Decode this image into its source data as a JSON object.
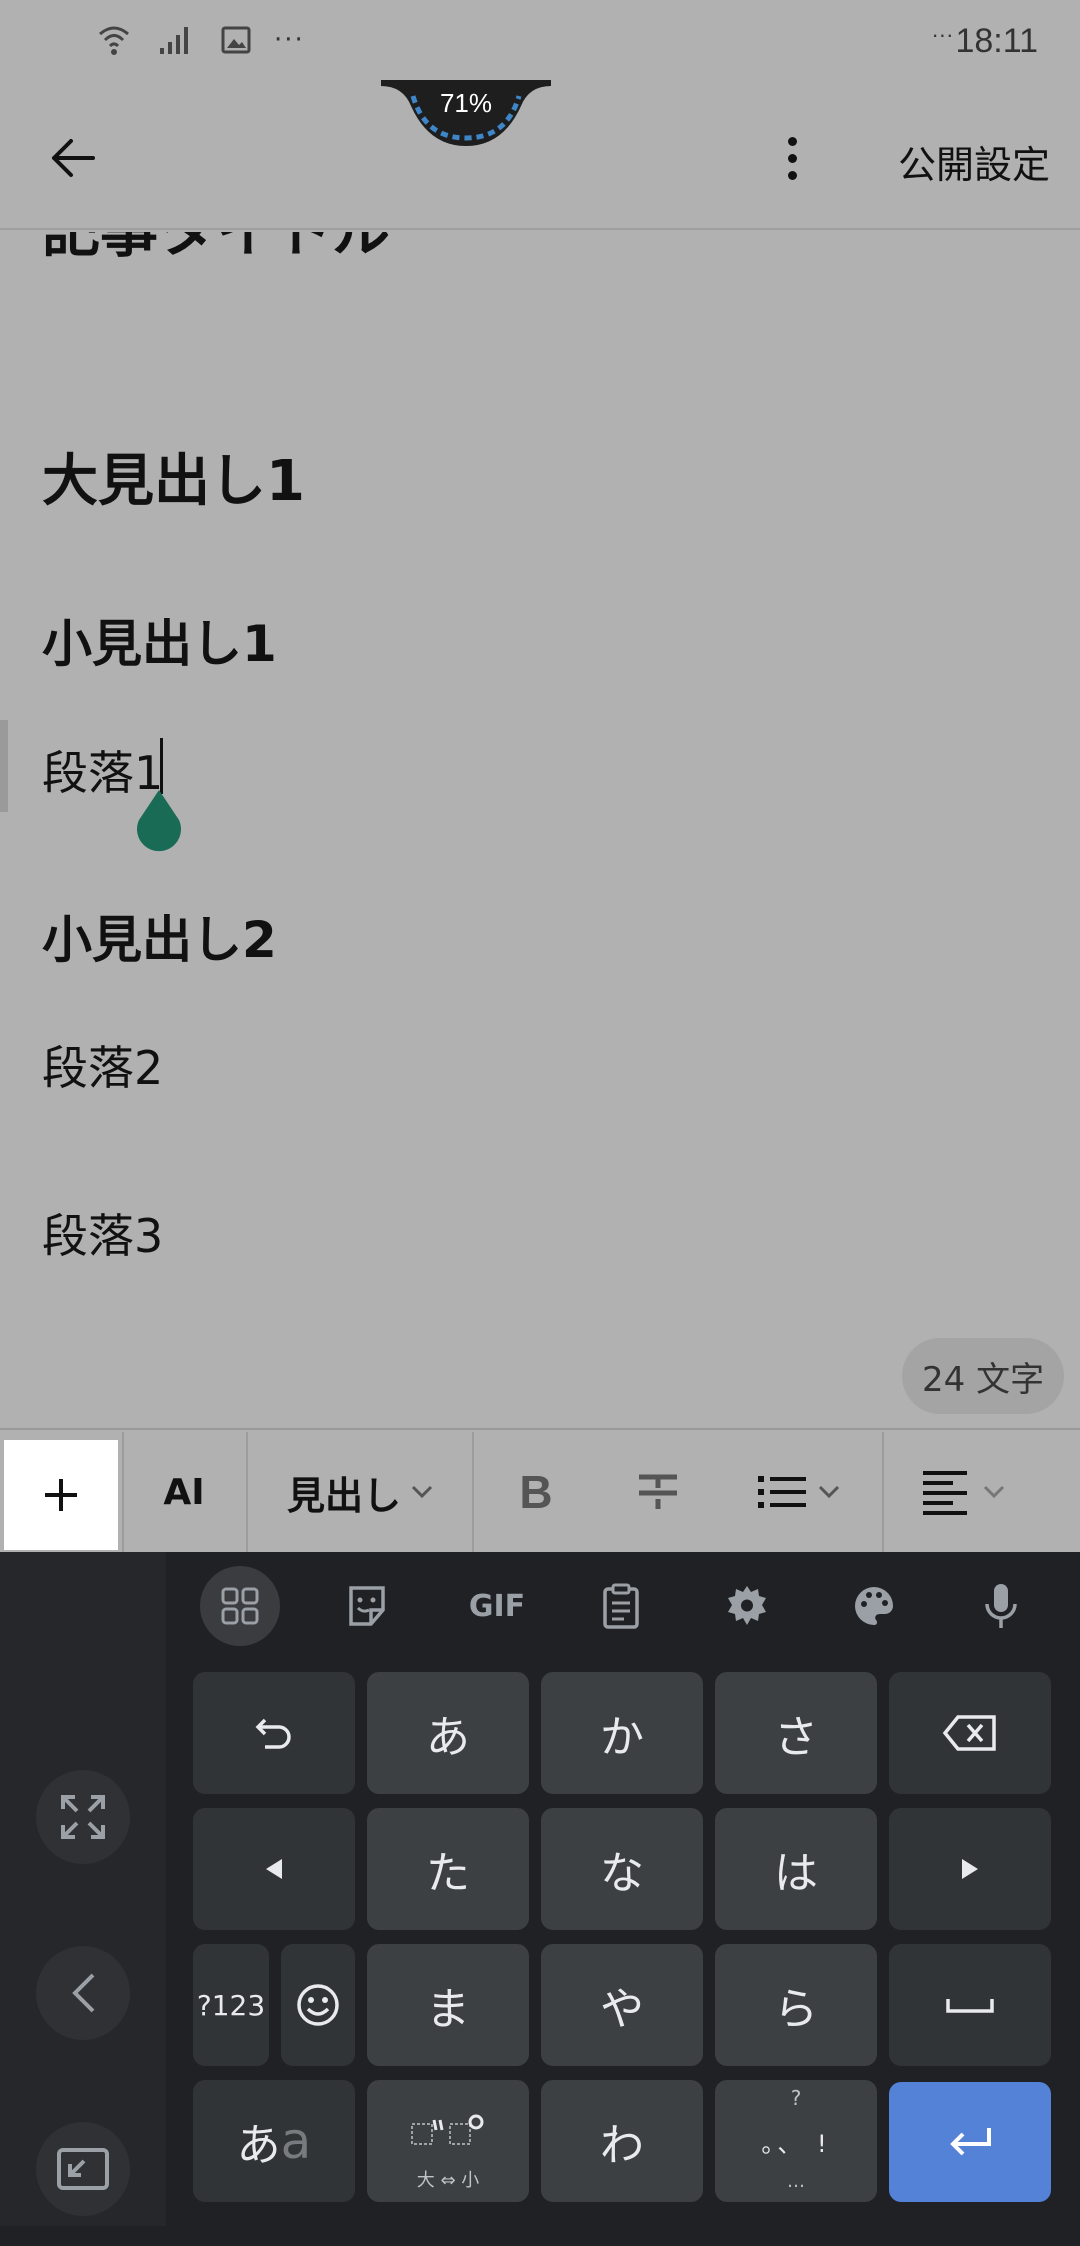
{
  "status_bar": {
    "time_prefix": "···",
    "time": "18:11",
    "overflow": "···",
    "battery_percent": "71%"
  },
  "app_bar": {
    "publish_label": "公開設定"
  },
  "editor": {
    "title_clipped": "記事タイトル",
    "heading_large_1": "大見出し1",
    "heading_small_1": "小見出し1",
    "paragraph_1": "段落1",
    "heading_small_2": "小見出し2",
    "paragraph_2": "段落2",
    "paragraph_3": "段落3",
    "char_count": "24 文字"
  },
  "toolbar": {
    "plus": "+",
    "ai": "AI",
    "heading": "見出し",
    "bold": "B"
  },
  "keyboard": {
    "top_row": {
      "gif": "GIF"
    },
    "keys": {
      "a": "あ",
      "ka": "か",
      "sa": "さ",
      "ta": "た",
      "na": "な",
      "ha": "は",
      "ma": "ま",
      "ya": "や",
      "ra": "ら",
      "wa": "わ",
      "num": "?123",
      "kana_a": "あ",
      "kana_a2": "a",
      "dakuten_sub": "大 ⇔ 小",
      "punct_sup": "?",
      "punct_main": "。、 !",
      "punct_sub": "…"
    }
  },
  "colors": {
    "background_dim": "#b1b1b1",
    "keyboard_bg": "#202124",
    "key_bg": "#3c4043",
    "enter_key": "#5382d7",
    "cursor_handle": "#1a6b55"
  }
}
